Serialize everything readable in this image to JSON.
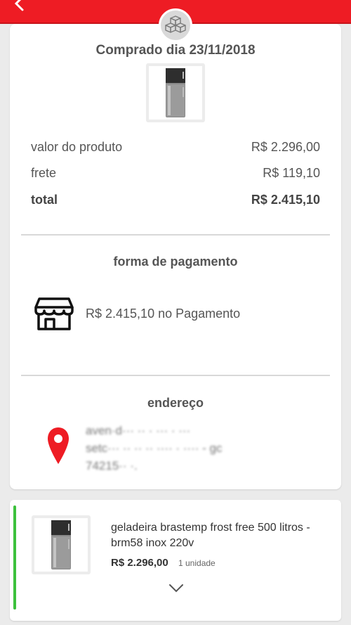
{
  "header": {
    "back_icon": "chevron-left-icon",
    "badge_icon": "boxes-icon",
    "accent_color": "#ee1c24"
  },
  "order": {
    "purchase_date": "Comprado dia 23/11/2018",
    "product_image": "geladeira-image"
  },
  "pricing": {
    "product_label": "valor do produto",
    "product_value": "R$ 2.296,00",
    "shipping_label": "frete",
    "shipping_value": "R$ 119,10",
    "total_label": "total",
    "total_value": "R$ 2.415,10"
  },
  "payment": {
    "title": "forma de pagamento",
    "icon": "store-icon",
    "text": "R$ 2.415,10 no Pagamento"
  },
  "address": {
    "title": "endereço",
    "icon": "map-pin-icon",
    "pin_color": "#ee1c24",
    "lines": [
      "aven·d··· ·· · ··· · ···",
      "setc··· ·· ·· ·· ···· · ···· - gc",
      "74215·· ·."
    ]
  },
  "item": {
    "name": "geladeira brastemp frost free 500 litros - brm58 inox 220v",
    "price": "R$ 2.296,00",
    "quantity": "1 unidade",
    "status_color": "#3cc13c",
    "expand_icon": "chevron-down-icon"
  }
}
